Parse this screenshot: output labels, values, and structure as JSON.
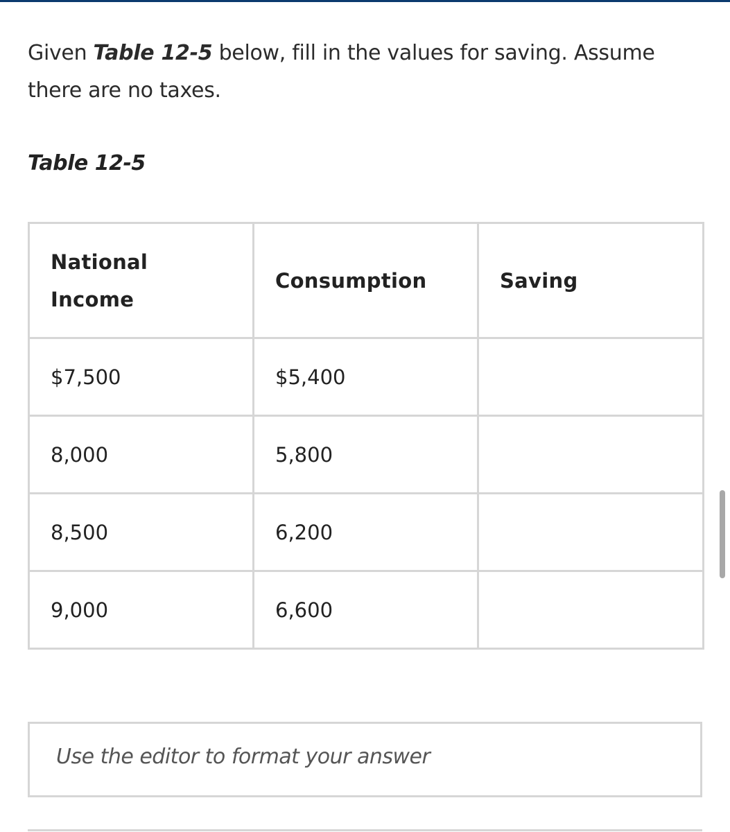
{
  "question": {
    "prefix": "Given ",
    "table_ref": "Table 12-5",
    "suffix": " below, fill in the values for saving. Assume there are no taxes."
  },
  "table": {
    "caption": "Table 12-5",
    "headers": {
      "national_income": "National Income",
      "consumption": "Consumption",
      "saving": "Saving"
    },
    "rows": [
      {
        "national_income": "$7,500",
        "consumption": "$5,400",
        "saving": ""
      },
      {
        "national_income": "8,000",
        "consumption": "5,800",
        "saving": ""
      },
      {
        "national_income": "8,500",
        "consumption": "6,200",
        "saving": ""
      },
      {
        "national_income": "9,000",
        "consumption": "6,600",
        "saving": ""
      }
    ]
  },
  "answer_editor": {
    "placeholder": "Use the editor to format your answer"
  },
  "colors": {
    "top_bar": "#0b3a6e",
    "border": "#d6d6d6",
    "text": "#222222",
    "placeholder": "#555555",
    "scrollbar": "#a8a8a8"
  }
}
